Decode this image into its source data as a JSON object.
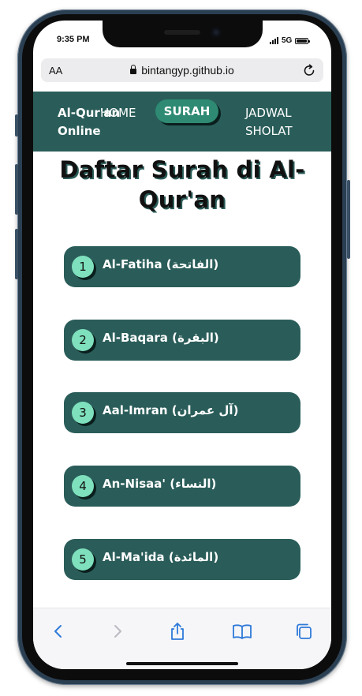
{
  "status": {
    "time": "9:35 PM",
    "network": "5G"
  },
  "browser": {
    "text_size": "AA",
    "url": "bintangyp.github.io"
  },
  "nav": {
    "brand_line1": "Al-Qur'an",
    "brand_line2": "Online",
    "home": "HOME",
    "surah": "SURAH",
    "jadwal_line1": "JADWAL",
    "jadwal_line2": "SHOLAT"
  },
  "page": {
    "title": "Daftar Surah di Al-Qur'an"
  },
  "surahs": [
    {
      "number": "1",
      "name": "Al-Fatiha (الفاتحة)"
    },
    {
      "number": "2",
      "name": "Al-Baqara (البقرة)"
    },
    {
      "number": "3",
      "name": "Aal-Imran (آل عمران)"
    },
    {
      "number": "4",
      "name": "An-Nisaa' (النساء)"
    },
    {
      "number": "5",
      "name": "Al-Ma'ida (المائدة)"
    }
  ],
  "toolbar": {
    "icons": [
      "chevron-left-icon",
      "chevron-right-icon",
      "share-icon",
      "bookmarks-icon",
      "tabs-icon"
    ]
  },
  "colors": {
    "primary": "#2a5d59",
    "active_nav": "#2e8a73",
    "number_badge": "#7ee0bc",
    "toolbar_icon": "#2f7ad9",
    "toolbar_icon_disabled": "#b9bcc2"
  }
}
